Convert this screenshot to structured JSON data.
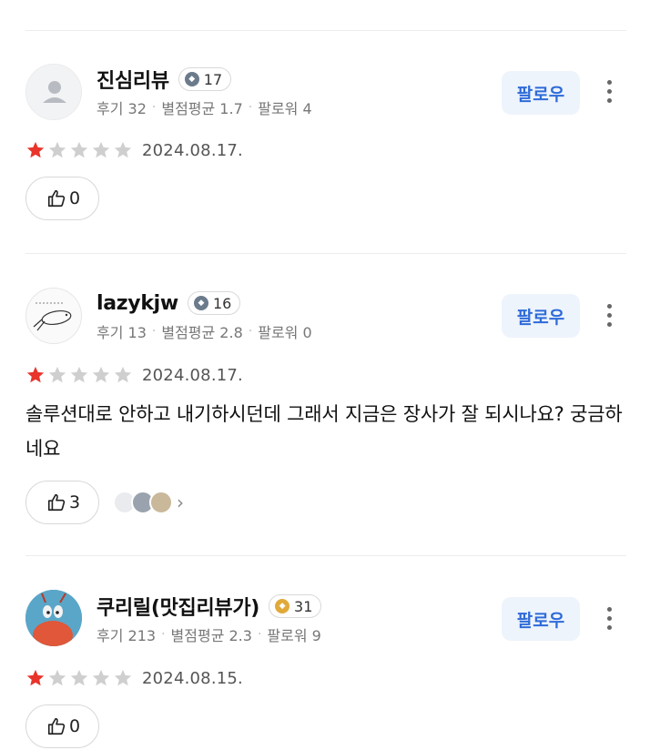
{
  "follow_label": "팔로우",
  "reviews": [
    {
      "name": "진심리뷰",
      "badge": "17",
      "badge_color": "#6b7b8c",
      "reviews_label": "후기 32",
      "avg_label": "별점평균 1.7",
      "followers_label": "팔로워 4",
      "rating": 1,
      "date": "2024.08.17.",
      "comment": "",
      "likes": "0"
    },
    {
      "name": "lazykjw",
      "badge": "16",
      "badge_color": "#6b7b8c",
      "reviews_label": "후기 13",
      "avg_label": "별점평균 2.8",
      "followers_label": "팔로워 0",
      "rating": 1,
      "date": "2024.08.17.",
      "comment": "솔루션대로 안하고 내기하시던데 그래서 지금은 장사가 잘 되시나요? 궁금하네요",
      "likes": "3"
    },
    {
      "name": "쿠리릴(맛집리뷰가)",
      "badge": "31",
      "badge_color": "#e0a93a",
      "reviews_label": "후기 213",
      "avg_label": "별점평균 2.3",
      "followers_label": "팔로워 9",
      "rating": 1,
      "date": "2024.08.15.",
      "comment": "",
      "likes": "0"
    }
  ],
  "colors": {
    "star_filled": "#e8342b",
    "star_empty": "#cfcfcf",
    "accent": "#2f6bd8"
  }
}
